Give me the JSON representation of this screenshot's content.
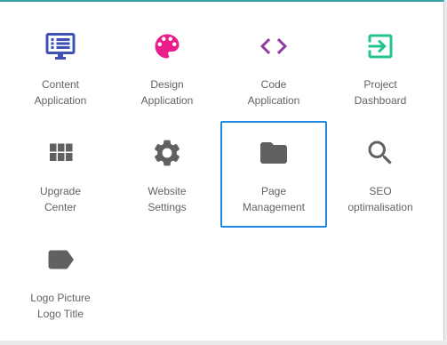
{
  "tiles": [
    {
      "name": "content-application",
      "icon": "monitor-list-icon",
      "color": "#3f51b5",
      "line1": "Content",
      "line2": "Application"
    },
    {
      "name": "design-application",
      "icon": "palette-icon",
      "color": "#e91e8c",
      "line1": "Design",
      "line2": "Application"
    },
    {
      "name": "code-application",
      "icon": "code-brackets-icon",
      "color": "#8e3da3",
      "line1": "Code",
      "line2": "Application"
    },
    {
      "name": "project-dashboard",
      "icon": "login-box-icon",
      "color": "#23c489",
      "line1": "Project",
      "line2": "Dashboard"
    },
    {
      "name": "upgrade-center",
      "icon": "grid-icon",
      "color": "#616161",
      "line1": "Upgrade",
      "line2": "Center"
    },
    {
      "name": "website-settings",
      "icon": "gear-icon",
      "color": "#616161",
      "line1": "Website",
      "line2": "Settings"
    },
    {
      "name": "page-management",
      "icon": "folder-icon",
      "color": "#616161",
      "line1": "Page",
      "line2": "Management",
      "selected": true
    },
    {
      "name": "seo-optimalisation",
      "icon": "magnifier-icon",
      "color": "#616161",
      "line1": "SEO",
      "line2": "optimalisation"
    },
    {
      "name": "logo-picture",
      "icon": "label-tag-icon",
      "color": "#616161",
      "line1": "Logo Picture",
      "line2": "Logo Title"
    }
  ],
  "colors": {
    "selection": "#1e88e5",
    "label": "#5f6368",
    "top_accent": "#3aa0a8"
  }
}
